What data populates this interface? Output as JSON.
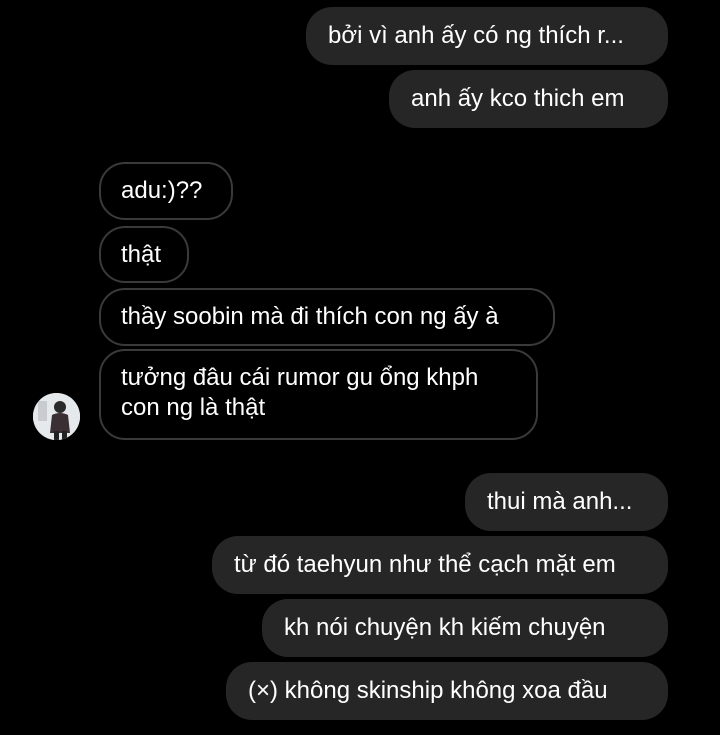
{
  "chat": {
    "sent_top": [
      "bởi vì anh ấy có ng thích r...",
      "anh ấy kco thich em"
    ],
    "received": [
      "adu:)??",
      "thật",
      "thầy soobin mà đi thích con ng ấy à",
      "tưởng đâu cái rumor gu ổng khph",
      "con ng là thật"
    ],
    "sent_bottom": [
      "thui mà anh...",
      "từ đó taehyun như thể cạch mặt em",
      "kh nói chuyện kh kiếm chuyện",
      "(×) không skinship không xoa đầu"
    ]
  },
  "avatar": {
    "icon": "contact-avatar"
  },
  "colors": {
    "background": "#000000",
    "sent_bubble": "#262626",
    "received_border": "#3a3a3a",
    "text": "#ffffff"
  }
}
